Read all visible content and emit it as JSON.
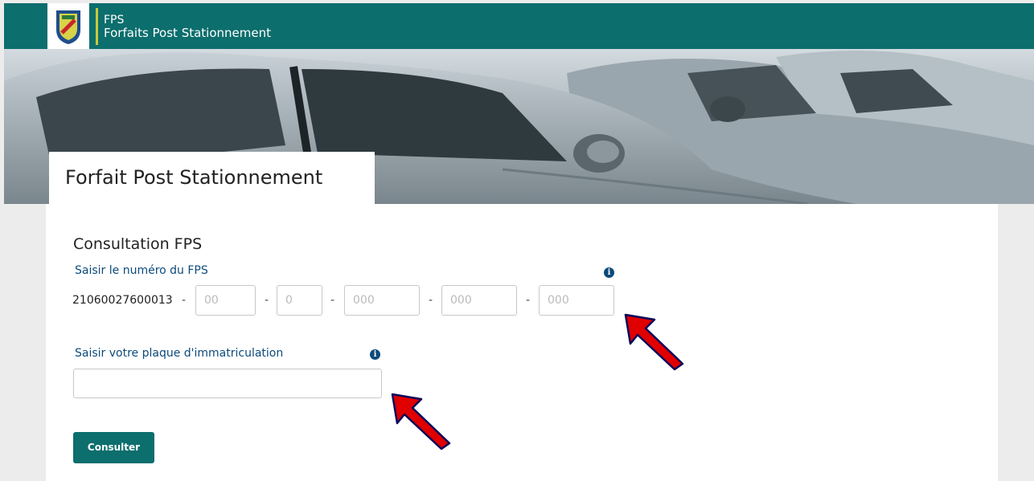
{
  "header": {
    "app_title": "FPS",
    "app_subtitle": "Forfaits Post Stationnement",
    "logo": "city-crest-logo"
  },
  "banner": {
    "title": "Forfait Post Stationnement"
  },
  "form": {
    "section_title": "Consultation FPS",
    "fps_label": "Saisir le numéro du FPS",
    "fps_prefix": "21060027600013",
    "separator": "-",
    "fps_fields": [
      {
        "placeholder": "00"
      },
      {
        "placeholder": "0"
      },
      {
        "placeholder": "000"
      },
      {
        "placeholder": "000"
      },
      {
        "placeholder": "000"
      }
    ],
    "plate_label": "Saisir votre plaque d'immatriculation",
    "plate_value": "",
    "info_icon": "i",
    "submit_label": "Consulter"
  },
  "colors": {
    "brand": "#0c6e6d",
    "label": "#0c4a7a",
    "accent_line": "#c9c93a",
    "annotation_arrow": "#e00000"
  }
}
